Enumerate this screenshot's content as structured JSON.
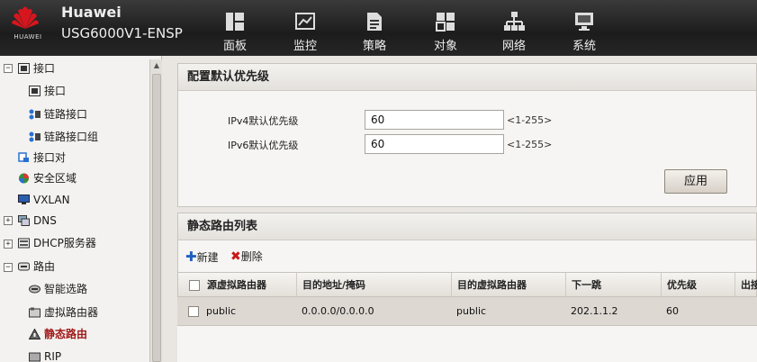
{
  "header": {
    "logo_text": "HUAWEI",
    "brand": "Huawei",
    "product": "USG6000V1-ENSP",
    "nav": [
      {
        "label": "面板",
        "icon": "dashboard-icon"
      },
      {
        "label": "监控",
        "icon": "monitor-chart-icon"
      },
      {
        "label": "策略",
        "icon": "policy-document-icon"
      },
      {
        "label": "对象",
        "icon": "object-icon"
      },
      {
        "label": "网络",
        "icon": "network-topology-icon"
      },
      {
        "label": "系统",
        "icon": "system-computer-icon"
      }
    ]
  },
  "sidebar": {
    "items": [
      {
        "label": "接口",
        "icon": "interface-folder-icon"
      },
      {
        "label": "接口",
        "icon": "interface-icon"
      },
      {
        "label": "链路接口",
        "icon": "link-interface-icon"
      },
      {
        "label": "链路接口组",
        "icon": "link-interface-group-icon"
      },
      {
        "label": "接口对",
        "icon": "interface-pair-icon"
      },
      {
        "label": "安全区域",
        "icon": "security-zone-icon"
      },
      {
        "label": "VXLAN",
        "icon": "vxlan-icon"
      },
      {
        "label": "DNS",
        "icon": "dns-icon"
      },
      {
        "label": "DHCP服务器",
        "icon": "dhcp-server-icon"
      },
      {
        "label": "路由",
        "icon": "route-folder-icon"
      },
      {
        "label": "智能选路",
        "icon": "smart-routing-icon"
      },
      {
        "label": "虚拟路由器",
        "icon": "virtual-router-icon"
      },
      {
        "label": "静态路由",
        "icon": "static-route-icon"
      },
      {
        "label": "RIP",
        "icon": "rip-icon"
      }
    ]
  },
  "priority_panel": {
    "title": "配置默认优先级",
    "ipv4_label": "IPv4默认优先级",
    "ipv4_value": "60",
    "ipv4_hint": "<1-255>",
    "ipv6_label": "IPv6默认优先级",
    "ipv6_value": "60",
    "ipv6_hint": "<1-255>",
    "apply_label": "应用"
  },
  "route_panel": {
    "title": "静态路由列表",
    "new_label": "新建",
    "delete_label": "删除",
    "columns": [
      "源虚拟路由器",
      "目的地址/掩码",
      "目的虚拟路由器",
      "下一跳",
      "优先级",
      "出接"
    ],
    "rows": [
      {
        "source_vr": "public",
        "dest": "0.0.0.0/0.0.0.0",
        "dest_vr": "public",
        "next_hop": "202.1.1.2",
        "priority": "60"
      }
    ]
  },
  "colors": {
    "header_bg": "#262626",
    "huawei_red": "#d6161e",
    "active_item": "#a01818",
    "row_bg": "#ddd8d2"
  }
}
